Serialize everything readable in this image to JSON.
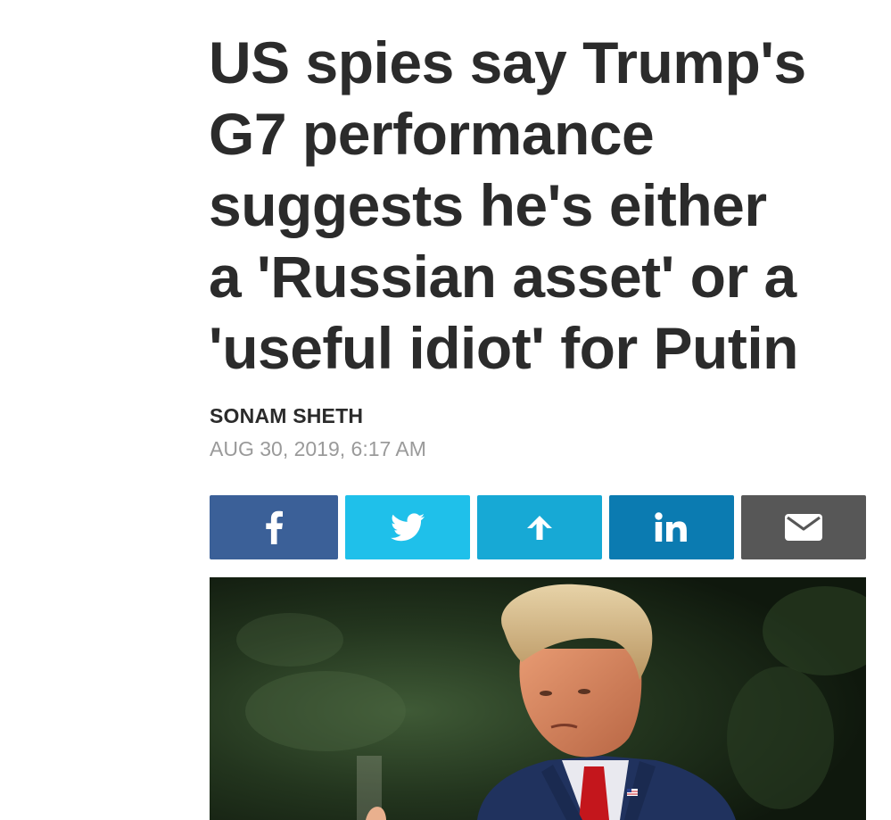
{
  "article": {
    "headline_lines": [
      "US spies say Trump's",
      "G7 performance",
      "suggests he's either",
      "a 'Russian asset' or a",
      "'useful idiot' for Putin"
    ],
    "author": "SONAM SHETH",
    "date": "AUG 30, 2019, 6:17 AM"
  },
  "share": {
    "buttons": [
      {
        "name": "facebook",
        "icon": "facebook-icon",
        "color": "#3b6098"
      },
      {
        "name": "twitter",
        "icon": "twitter-icon",
        "color": "#1fc0ea"
      },
      {
        "name": "share",
        "icon": "arrow-up-icon",
        "color": "#17a9d5"
      },
      {
        "name": "linkedin",
        "icon": "linkedin-icon",
        "color": "#0b7bb1"
      },
      {
        "name": "email",
        "icon": "envelope-icon",
        "color": "#575757"
      }
    ]
  },
  "colors": {
    "headline_text": "#2b2b2b",
    "date_text": "#9a9a9a"
  }
}
